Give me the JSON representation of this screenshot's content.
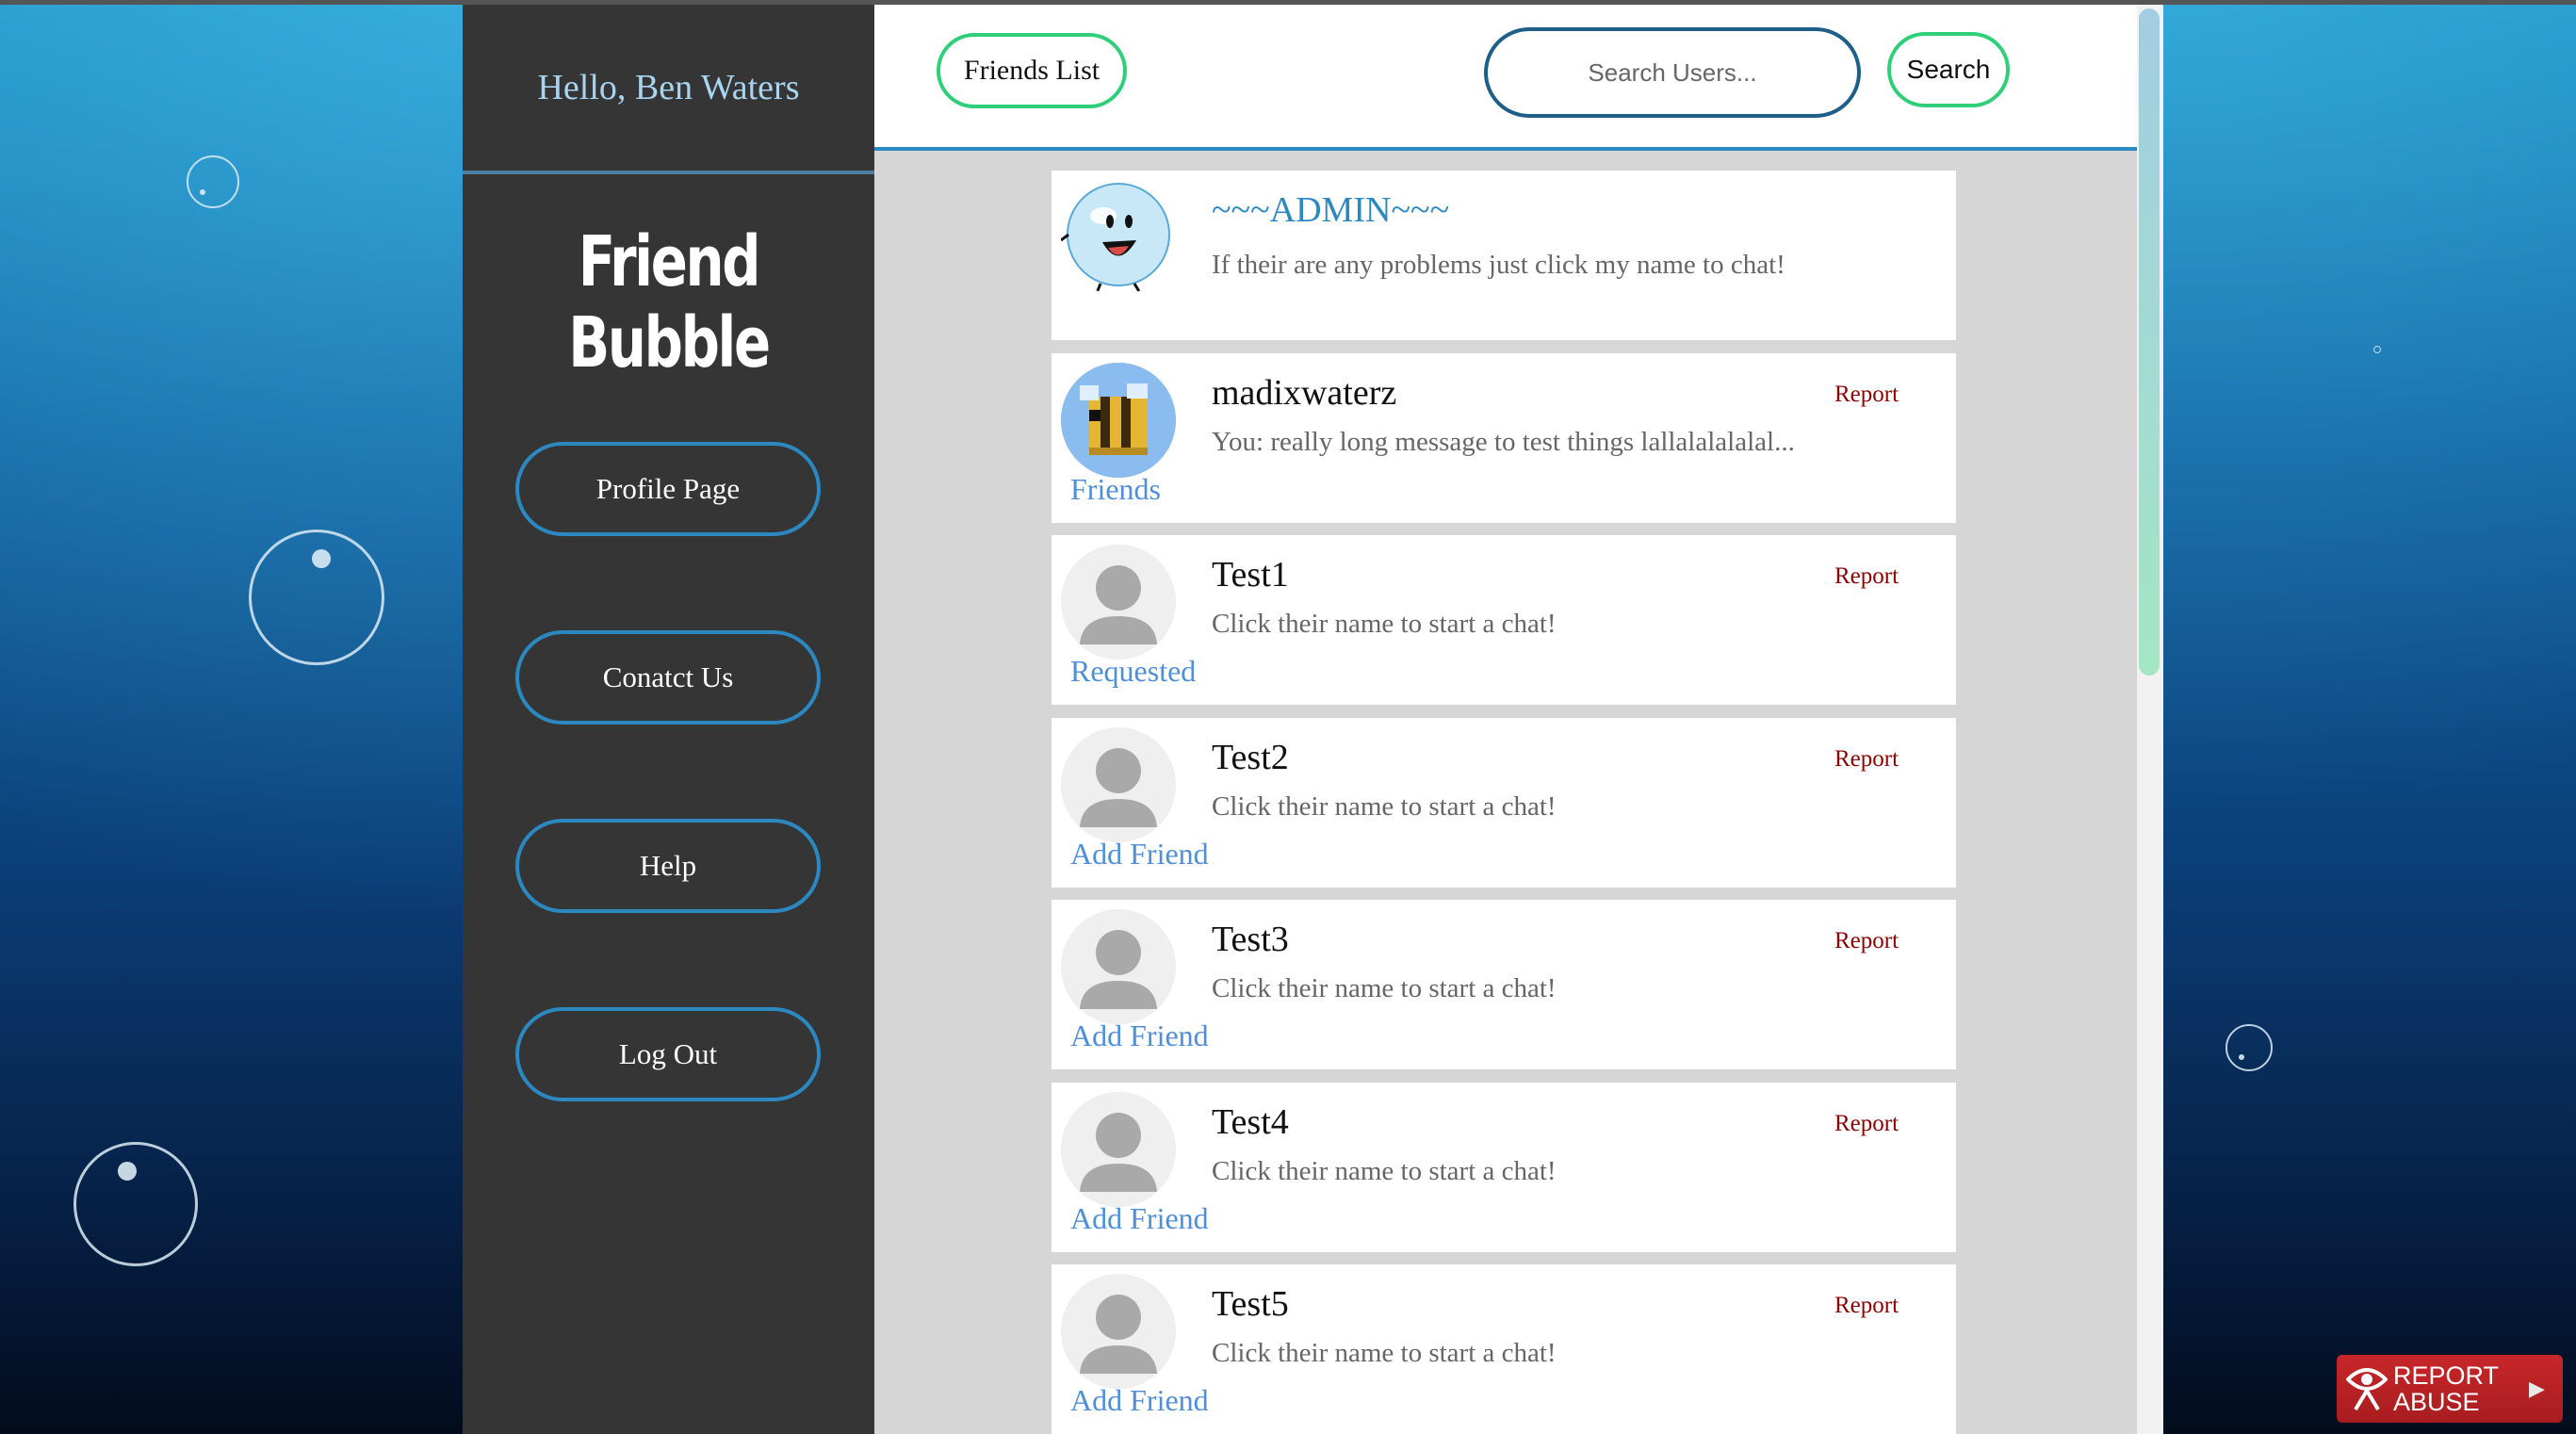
{
  "sidebar": {
    "greeting": "Hello, Ben Waters",
    "brand": "Friend Bubble",
    "nav": [
      {
        "label": "Profile Page"
      },
      {
        "label": "Conatct Us"
      },
      {
        "label": "Help"
      },
      {
        "label": "Log Out"
      }
    ]
  },
  "topbar": {
    "friends_list_label": "Friends List",
    "search_placeholder": "Search Users...",
    "search_button_label": "Search"
  },
  "cards": [
    {
      "name": "~~~ADMIN~~~",
      "message": "If their are any problems just click my name to chat!",
      "report": "",
      "status": "",
      "avatar": "admin-bubble"
    },
    {
      "name": "madixwaterz",
      "message": "You: really long message to test things lallalalalalal...",
      "report": "Report",
      "status": "Friends",
      "avatar": "bee"
    },
    {
      "name": "Test1",
      "message": "Click their name to start a chat!",
      "report": "Report",
      "status": "Requested",
      "avatar": "default-user"
    },
    {
      "name": "Test2",
      "message": "Click their name to start a chat!",
      "report": "Report",
      "status": "Add Friend",
      "avatar": "default-user"
    },
    {
      "name": "Test3",
      "message": "Click their name to start a chat!",
      "report": "Report",
      "status": "Add Friend",
      "avatar": "default-user"
    },
    {
      "name": "Test4",
      "message": "Click their name to start a chat!",
      "report": "Report",
      "status": "Add Friend",
      "avatar": "default-user"
    },
    {
      "name": "Test5",
      "message": "Click their name to start a chat!",
      "report": "Report",
      "status": "Add Friend",
      "avatar": "default-user"
    }
  ],
  "report_abuse": {
    "line1": "REPORT",
    "line2": "ABUSE"
  },
  "colors": {
    "sidebar_bg": "#353535",
    "nav_border": "#2b88c0",
    "pill_border": "#2fcf79",
    "report_text": "#8b0000",
    "status_text": "#4e8fd8"
  }
}
